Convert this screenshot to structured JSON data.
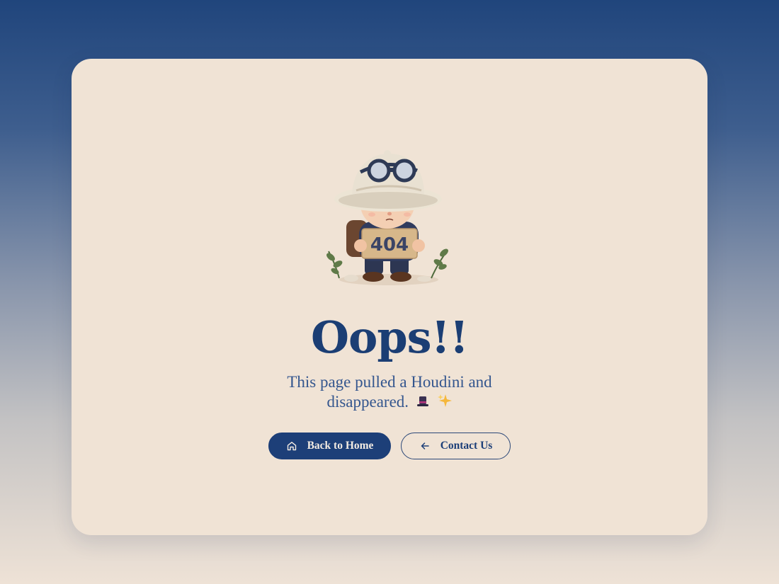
{
  "error": {
    "code": "404",
    "title": "Oops!!",
    "message_line1": "This page pulled a Houdini and",
    "message_line2": "disappeared."
  },
  "actions": {
    "home_label": "Back to Home",
    "contact_label": "Contact Us"
  },
  "icons": {
    "home": "home-icon",
    "contact": "arrow-left-icon",
    "hat_emoji": "top-hat-icon",
    "sparkle_emoji": "sparkles-icon"
  },
  "colors": {
    "primary": "#1d3f78",
    "card": "#f0e3d5",
    "text_secondary": "#34568e"
  }
}
